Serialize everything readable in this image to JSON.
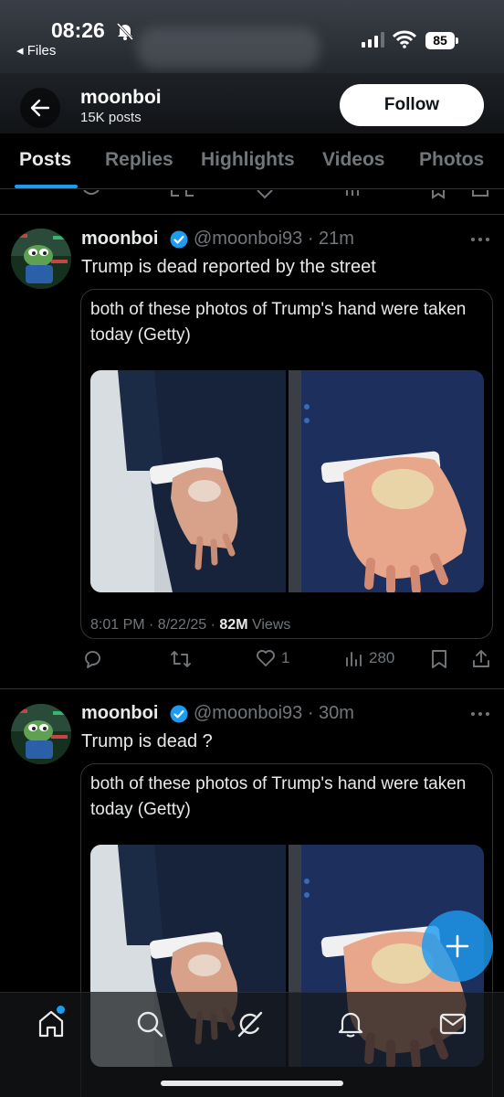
{
  "status_bar": {
    "time": "08:26",
    "back_app": "◂ Files",
    "battery": "85"
  },
  "header": {
    "name": "moonboi",
    "post_count": "15K posts",
    "follow_label": "Follow"
  },
  "tabs": [
    {
      "label": "Posts",
      "active": true
    },
    {
      "label": "Replies",
      "active": false
    },
    {
      "label": "Highlights",
      "active": false
    },
    {
      "label": "Videos",
      "active": false
    },
    {
      "label": "Photos",
      "active": false
    }
  ],
  "tweets": [
    {
      "name": "moonboi",
      "handle": "@moonboi93",
      "time": "· 21m",
      "text": "Trump is dead reported by the street",
      "quote": {
        "text": "both of these photos of Trump's hand were taken today (Getty)",
        "timestamp": "8:01 PM · 8/22/25 · ",
        "views_count": "82M",
        "views_label": " Views"
      },
      "actions": {
        "likes": "1",
        "views": "280"
      }
    },
    {
      "name": "moonboi",
      "handle": "@moonboi93",
      "time": "· 30m",
      "text": "Trump is dead ?",
      "quote": {
        "text": "both of these photos of Trump's hand were taken today (Getty)"
      }
    }
  ],
  "colors": {
    "accent": "#1d9bf0",
    "background": "#000000",
    "text_primary": "#e7e9ea",
    "text_secondary": "#71767b",
    "border": "#2f3336"
  },
  "icons": [
    "back-arrow-icon",
    "verified-badge-icon",
    "more-icon",
    "reply-icon",
    "repost-icon",
    "like-icon",
    "views-icon",
    "bookmark-icon",
    "share-icon",
    "compose-icon",
    "home-icon",
    "search-icon",
    "grok-icon",
    "notifications-icon",
    "messages-icon"
  ]
}
